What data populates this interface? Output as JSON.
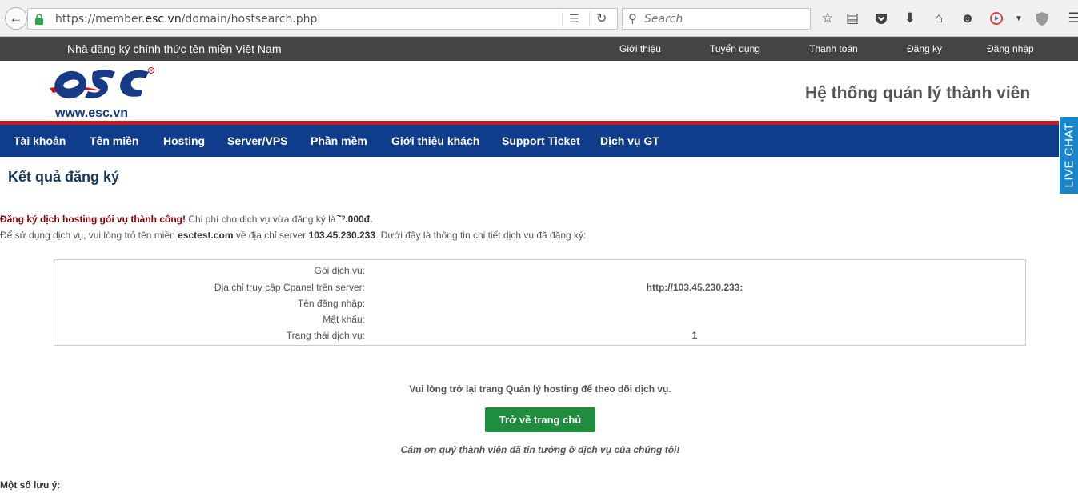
{
  "browser": {
    "url_prefix": "https://member.",
    "url_domain": "esc.vn",
    "url_suffix": "/domain/hostsearch.php",
    "search_placeholder": "Search"
  },
  "topbar": {
    "tagline": "Nhà đăng ký chính thức tên miền Việt Nam",
    "links": [
      "Giới thiệu",
      "Tuyển dụng",
      "Thanh toán",
      "Đăng ký",
      "Đăng nhập"
    ]
  },
  "header": {
    "logo_text": "www.esc.vn",
    "title": "Hệ thống quản lý thành viên"
  },
  "mainnav": {
    "items": [
      "Tài khoản",
      "Tên miền",
      "Hosting",
      "Server/VPS",
      "Phần mềm",
      "Giới thiệu khách",
      "Support Ticket",
      "Dịch vụ GT"
    ]
  },
  "livechat": "LIVE CHAT",
  "content": {
    "heading": "Kết quả đăng ký",
    "success_text": "Đăng ký dịch hosting gói vụ thành công!",
    "cost_text": " Chi phí cho dịch vụ vừa đăng ký là ",
    "cost_value": "̄˘ˀ.000đ.",
    "line2_a": "Để sử dụng dịch vụ, vui lòng trỏ tên miền ",
    "domain": "esctest.com",
    "line2_b": " về địa chỉ server ",
    "server_ip": "103.45.230.233",
    "line2_c": ". Dưới đây là thông tin chi tiết dịch vụ đã đăng ký:",
    "details": [
      {
        "label": "Gói dịch vụ:",
        "value": ""
      },
      {
        "label": "Địa chỉ truy cập Cpanel trên server:",
        "value": "http://103.45.230.233:"
      },
      {
        "label": "Tên đăng nhập:",
        "value": ""
      },
      {
        "label": "Mật khẩu:",
        "value": ""
      },
      {
        "label": "Trạng thái dịch vụ:",
        "value": "1"
      }
    ],
    "return_note": "Vui lòng trở lại trang Quản lý hosting để theo dõi dịch vụ.",
    "home_button": "Trở về trang chủ",
    "thanks": "Cám ơn quý thành viên đã tin tưởng ở dịch vụ của chúng tôi!",
    "notes_heading": "Một số lưu ý:"
  }
}
